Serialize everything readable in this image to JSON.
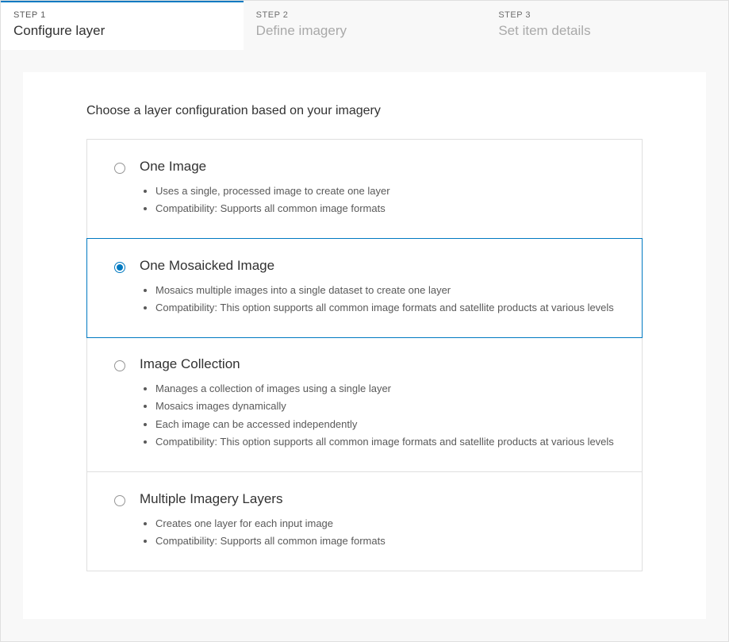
{
  "stepper": {
    "steps": [
      {
        "label": "STEP 1",
        "title": "Configure layer",
        "active": true
      },
      {
        "label": "STEP 2",
        "title": "Define imagery",
        "active": false
      },
      {
        "label": "STEP 3",
        "title": "Set item details",
        "active": false
      }
    ]
  },
  "panel": {
    "heading": "Choose a layer configuration based on your imagery"
  },
  "options": [
    {
      "id": "one-image",
      "title": "One Image",
      "selected": false,
      "bullets": [
        "Uses a single, processed image to create one layer",
        "Compatibility: Supports all common image formats"
      ]
    },
    {
      "id": "one-mosaicked-image",
      "title": "One Mosaicked Image",
      "selected": true,
      "bullets": [
        "Mosaics multiple images into a single dataset to create one layer",
        "Compatibility: This option supports all common image formats and satellite products at various levels"
      ]
    },
    {
      "id": "image-collection",
      "title": "Image Collection",
      "selected": false,
      "bullets": [
        "Manages a collection of images using a single layer",
        "Mosaics images dynamically",
        "Each image can be accessed independently",
        "Compatibility: This option supports all common image formats and satellite products at various levels"
      ]
    },
    {
      "id": "multiple-imagery-layers",
      "title": "Multiple Imagery Layers",
      "selected": false,
      "bullets": [
        "Creates one layer for each input image",
        "Compatibility: Supports all common image formats"
      ]
    }
  ]
}
